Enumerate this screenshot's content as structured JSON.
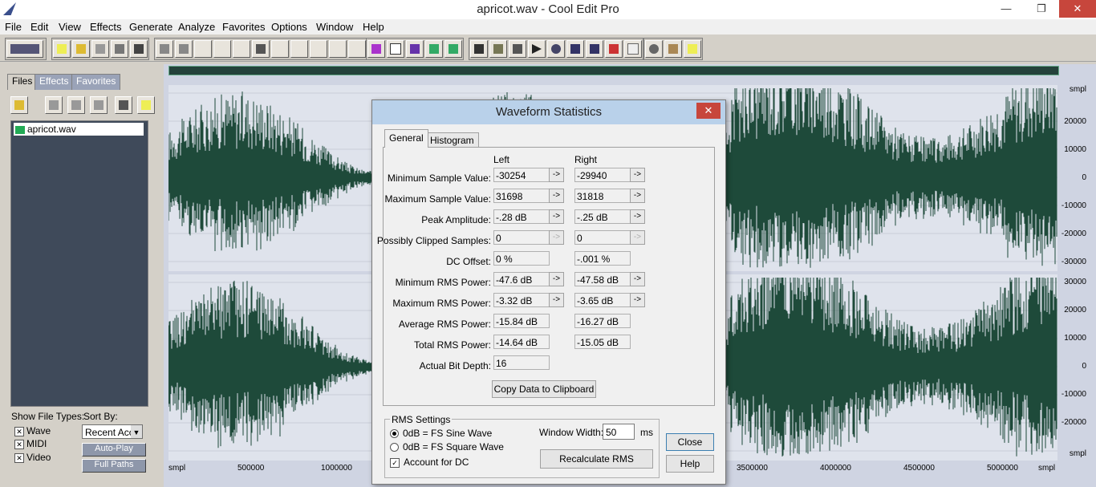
{
  "window": {
    "title": "apricot.wav - Cool Edit Pro"
  },
  "menu": [
    "File",
    "Edit",
    "View",
    "Effects",
    "Generate",
    "Analyze",
    "Favorites",
    "Options",
    "Window",
    "Help"
  ],
  "left_tabs": [
    "Files",
    "Effects",
    "Favorites"
  ],
  "files": [
    "apricot.wav"
  ],
  "show_file_types": {
    "label": "Show File Types:",
    "items": [
      "Wave",
      "MIDI",
      "Video"
    ]
  },
  "sort_by": {
    "label": "Sort By:",
    "value": "Recent Acc"
  },
  "left_buttons": {
    "auto_play": "Auto-Play",
    "full_paths": "Full Paths"
  },
  "ruler_top": [
    "smpl",
    "20000",
    "10000",
    "0",
    "-10000",
    "-20000",
    "-30000"
  ],
  "ruler_bottom": [
    "30000",
    "20000",
    "10000",
    "0",
    "-10000",
    "-20000",
    "smpl"
  ],
  "timeline": {
    "unit": "smpl",
    "labels": [
      "500000",
      "1000000",
      "3500000",
      "4000000",
      "4500000",
      "5000000"
    ]
  },
  "dialog": {
    "title": "Waveform Statistics",
    "close": "✕",
    "tabs": [
      "General",
      "Histogram"
    ],
    "col_left": "Left",
    "col_right": "Right",
    "rows": [
      {
        "label": "Minimum Sample Value:",
        "left": "-30254",
        "right": "-29940"
      },
      {
        "label": "Maximum Sample Value:",
        "left": "31698",
        "right": "31818"
      },
      {
        "label": "Peak Amplitude:",
        "left": "-.28 dB",
        "right": "-.25 dB"
      },
      {
        "label": "Possibly Clipped Samples:",
        "left": "0",
        "right": "0"
      },
      {
        "label": "DC Offset:",
        "left": "0 %",
        "right": "-.001 %"
      },
      {
        "label": "Minimum RMS Power:",
        "left": "-47.6 dB",
        "right": "-47.58 dB"
      },
      {
        "label": "Maximum RMS Power:",
        "left": "-3.32 dB",
        "right": "-3.65 dB"
      },
      {
        "label": "Average RMS Power:",
        "left": "-15.84 dB",
        "right": "-16.27 dB"
      },
      {
        "label": "Total RMS Power:",
        "left": "-14.64 dB",
        "right": "-15.05 dB"
      },
      {
        "label": "Actual Bit Depth:",
        "left": "16",
        "right": ""
      }
    ],
    "copy_button": "Copy Data to Clipboard",
    "rms": {
      "group_label": "RMS Settings",
      "sine": "0dB = FS Sine Wave",
      "square": "0dB = FS Square Wave",
      "account_dc": "Account for DC",
      "window_width_label": "Window Width:",
      "window_width_value": "50",
      "ms": "ms",
      "recalc": "Recalculate RMS"
    },
    "close_button": "Close",
    "help_button": "Help",
    "arrow": "->"
  }
}
